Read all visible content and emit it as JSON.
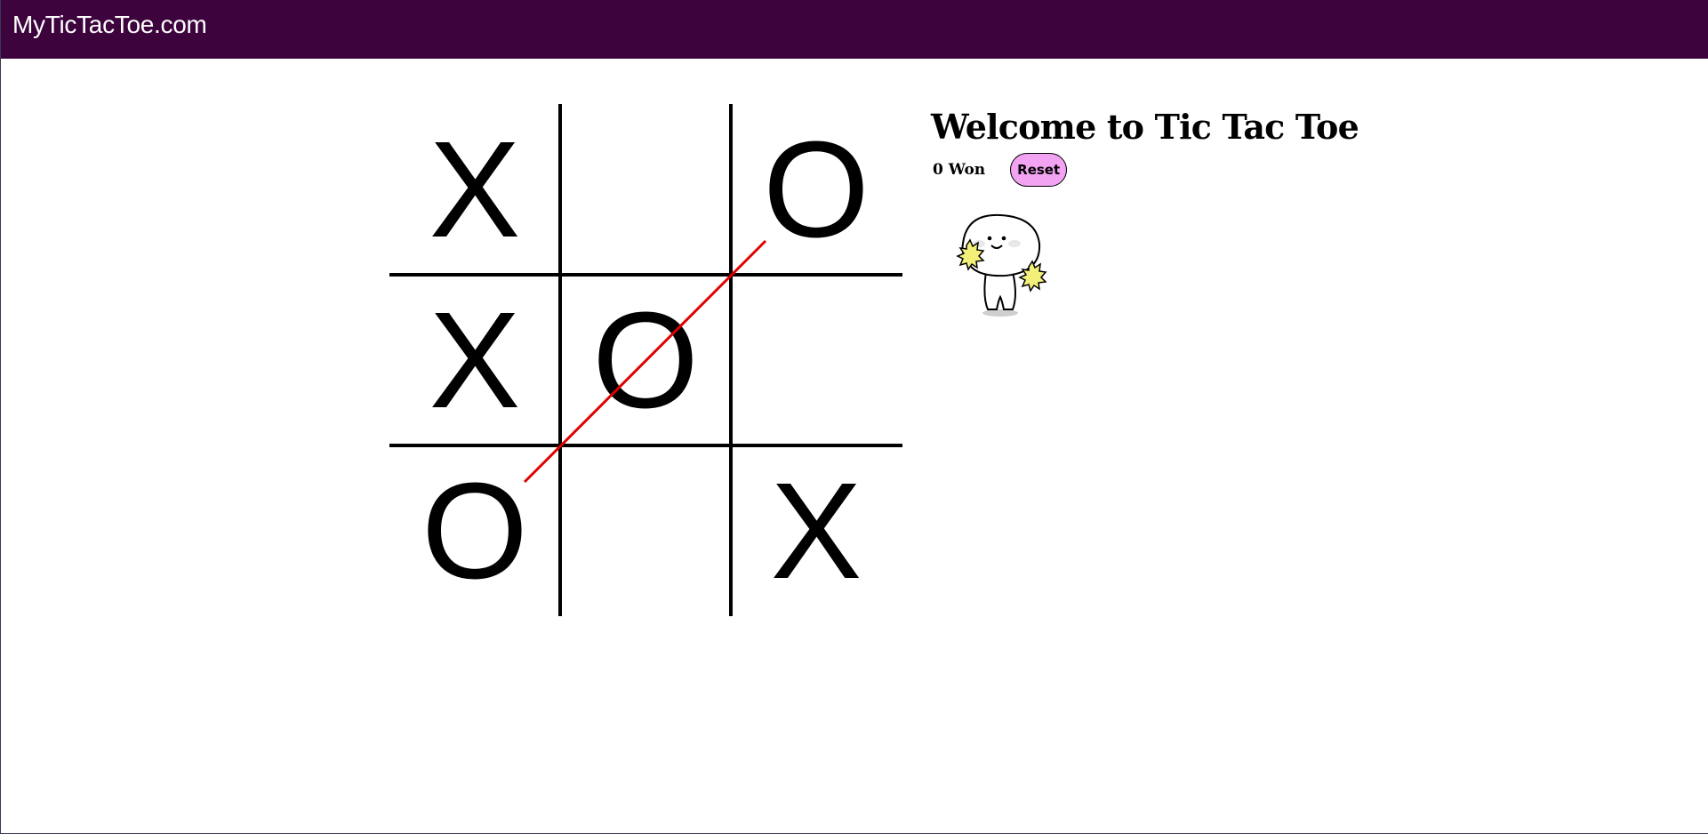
{
  "header": {
    "brand": "MyTicTacToe.com",
    "bg_color": "#3d033d"
  },
  "game": {
    "board": [
      [
        "X",
        "",
        "O"
      ],
      [
        "X",
        "O",
        ""
      ],
      [
        "O",
        "",
        "X"
      ]
    ],
    "winning_line": [
      [
        2,
        0
      ],
      [
        1,
        1
      ],
      [
        0,
        2
      ]
    ],
    "winning_line_color": "#e00000"
  },
  "sidebar": {
    "title": "Welcome to Tic Tac Toe",
    "score_text": "0 Won",
    "reset_label": "Reset",
    "reset_color": "#f2a3f2",
    "mascot_icon": "cheerleader-mascot-icon"
  }
}
